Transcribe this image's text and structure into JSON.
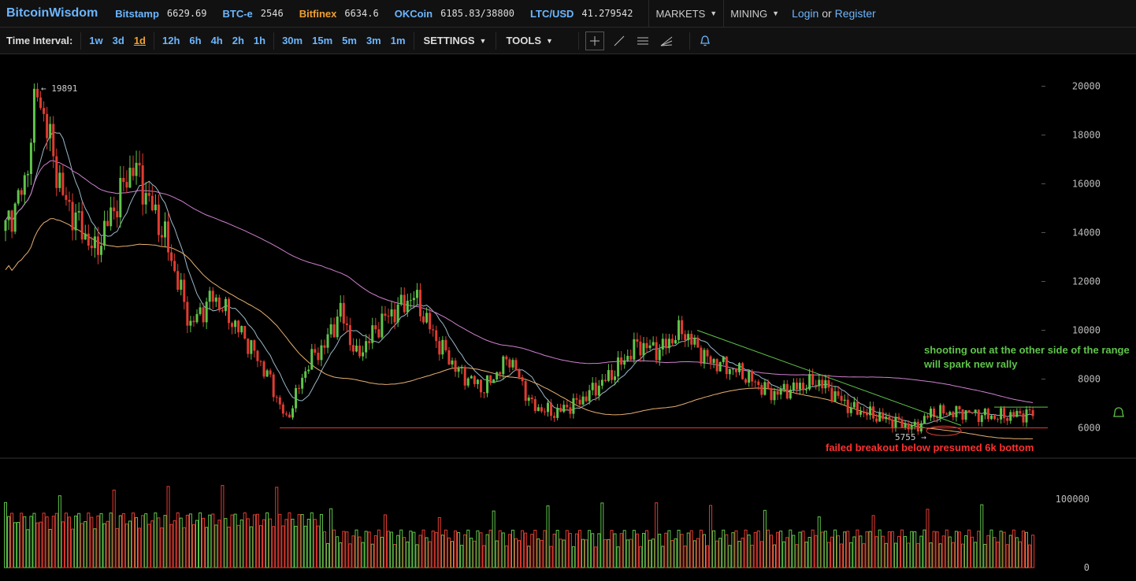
{
  "topbar": {
    "logo": "BitcoinWisdom",
    "tickers": [
      {
        "exchange": "Bitstamp",
        "price": "6629.69",
        "color": "#6cb6ff"
      },
      {
        "exchange": "BTC-e",
        "price": "2546",
        "color": "#6cb6ff"
      },
      {
        "exchange": "Bitfinex",
        "price": "6634.6",
        "color": "#f0a030"
      },
      {
        "exchange": "OKCoin",
        "price": "6185.83/38800",
        "color": "#6cb6ff"
      },
      {
        "exchange": "LTC/USD",
        "price": "41.279542",
        "color": "#6cb6ff"
      }
    ],
    "markets_label": "MARKETS",
    "mining_label": "MINING",
    "login_label": "Login",
    "or_label": "or",
    "register_label": "Register"
  },
  "toolbar": {
    "time_interval_label": "Time Interval:",
    "interval_groups": [
      [
        "1w",
        "3d",
        "1d"
      ],
      [
        "12h",
        "6h",
        "4h",
        "2h",
        "1h"
      ],
      [
        "30m",
        "15m",
        "5m",
        "3m",
        "1m"
      ]
    ],
    "active_interval": "1d",
    "settings_label": "SETTINGS",
    "tools_label": "TOOLS",
    "tool_icons": [
      "crosshair-icon",
      "line-draw-icon",
      "horizontal-lines-icon",
      "fan-lines-icon",
      "bell-icon"
    ]
  },
  "chart_data": {
    "type": "candlestick",
    "price_axis": {
      "ticks": [
        "20000",
        "18000",
        "16000",
        "14000",
        "12000",
        "10000",
        "8000",
        "6000"
      ],
      "min": 6000,
      "max": 20000
    },
    "volume_axis": {
      "ticks": [
        "100000",
        "0"
      ],
      "max": 100000
    },
    "high_marker": "← 19891",
    "low_marker": "5755 →",
    "support_level": 6000,
    "annotations": {
      "green": [
        "shooting out at the other side of the range",
        "will spark new rally"
      ],
      "red": "failed breakout below presumed 6k bottom"
    },
    "colors": {
      "up": "#5fc44a",
      "down": "#e03c31",
      "ma_short": "#9ab8c8",
      "ma_mid": "#e8b070",
      "ma_long": "#d080d0",
      "support": "#e03c31",
      "trend": "#5fc44a",
      "annot_green": "#5fc44a",
      "annot_red": "#ff3030"
    }
  }
}
